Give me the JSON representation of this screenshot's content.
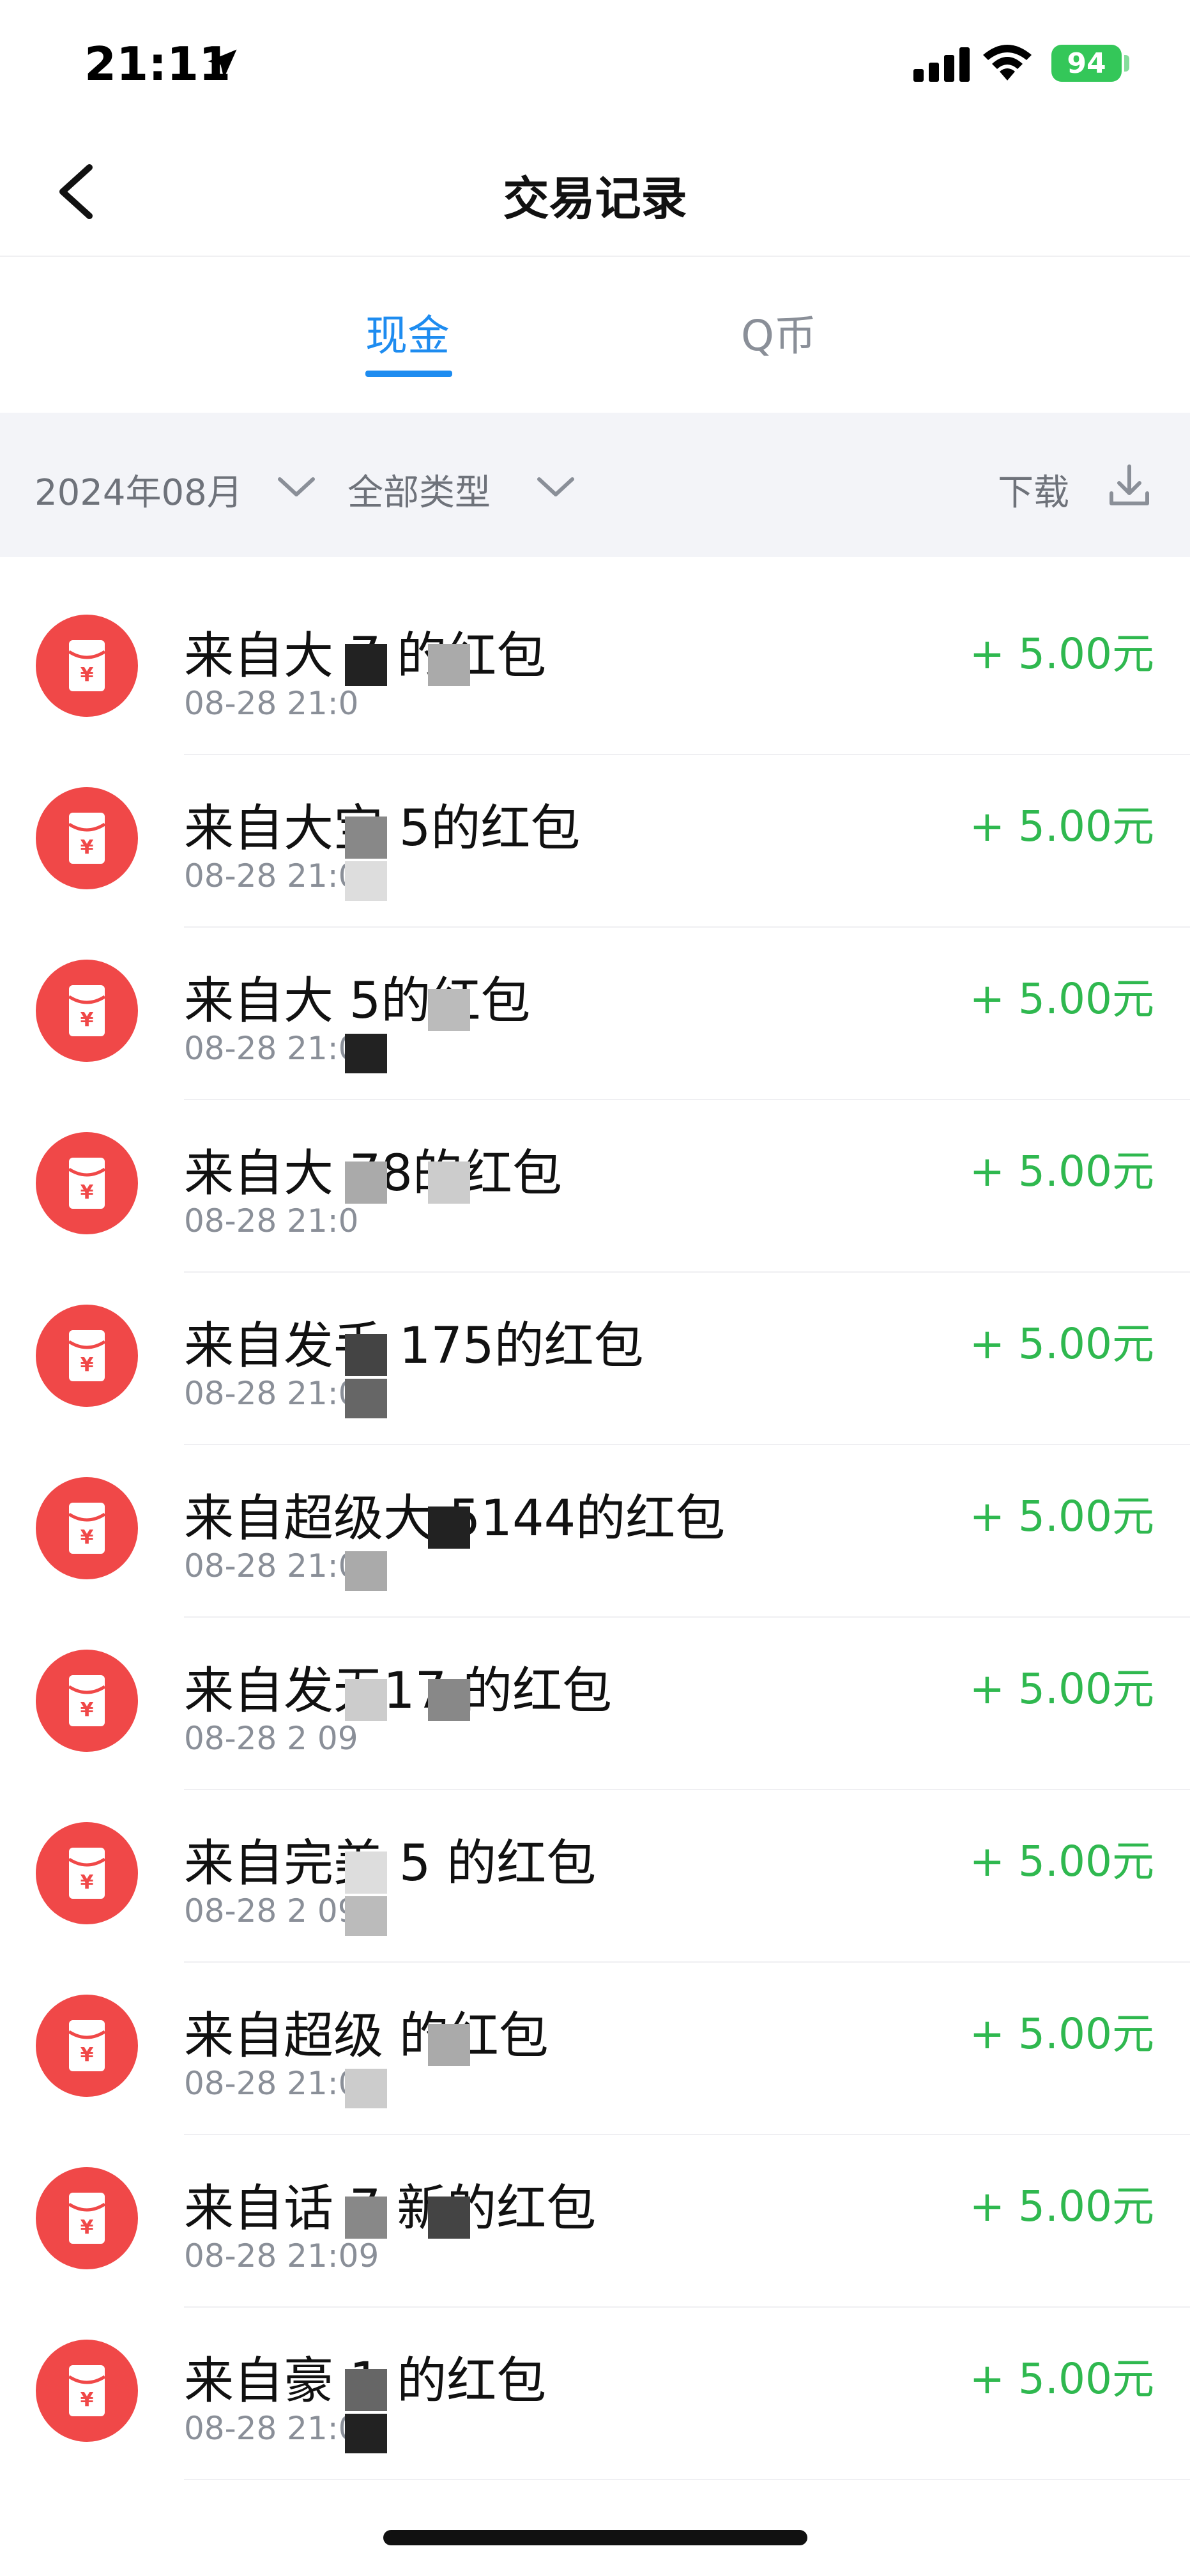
{
  "status_bar": {
    "time": "21:11",
    "battery": "94",
    "icons": [
      "location-arrow-icon",
      "signal-icon",
      "wifi-icon",
      "battery-charging-icon"
    ]
  },
  "nav": {
    "title": "交易记录",
    "back_icon": "chevron-left-icon"
  },
  "tabs": [
    {
      "label": "现金",
      "active": true
    },
    {
      "label": "Q币",
      "active": false
    }
  ],
  "filter": {
    "month": "2024年08月",
    "type": "全部类型",
    "download": "下载",
    "chevron_icon": "chevron-down-icon",
    "download_icon": "download-icon"
  },
  "colors": {
    "accent": "#1e8cf0",
    "income": "#2fb84f",
    "avatar": "#f04848",
    "filter_bg": "#f3f4f8"
  },
  "transactions": [
    {
      "title": "来自大 7  的红包",
      "time": "08-28 21:0",
      "amount": "+ 5.00元"
    },
    {
      "title": "来自大宝  5的红包",
      "time": "08-28 21:0",
      "amount": "+ 5.00元"
    },
    {
      "title": "来自大   5的红包",
      "time": "08-28 21:0",
      "amount": "+ 5.00元"
    },
    {
      "title": "来自大  78的红包",
      "time": "08-28 21:0",
      "amount": "+ 5.00元"
    },
    {
      "title": "来自发手 175的红包",
      "time": "08-28 21:09",
      "amount": "+ 5.00元"
    },
    {
      "title": "来自超级大  5144的红包",
      "time": "08-28 21:0",
      "amount": "+ 5.00元"
    },
    {
      "title": "来自发无17 的红包",
      "time": "08-28 2  09",
      "amount": "+ 5.00元"
    },
    {
      "title": "来自完美  5  的红包",
      "time": "08-28 2  09",
      "amount": "+ 5.00元"
    },
    {
      "title": "来自超级   的红包",
      "time": "08-28 21:0",
      "amount": "+ 5.00元"
    },
    {
      "title": "来自话  7 新的红包",
      "time": "08-28 21:09",
      "amount": "+ 5.00元"
    },
    {
      "title": "来自豪  1  的红包",
      "time": "08-28 21:0",
      "amount": "+ 5.00元"
    }
  ]
}
